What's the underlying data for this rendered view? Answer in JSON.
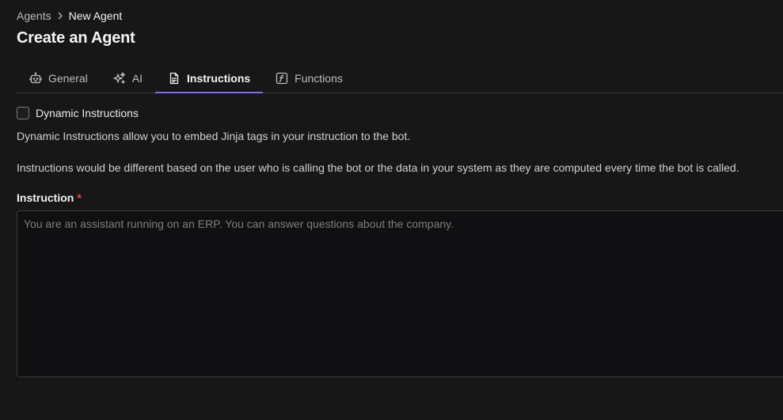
{
  "breadcrumb": {
    "parent": "Agents",
    "current": "New Agent",
    "separator_icon": "chevron-right-icon"
  },
  "page": {
    "title": "Create an Agent"
  },
  "tabs": [
    {
      "label": "General",
      "icon": "robot-icon",
      "active": false
    },
    {
      "label": "AI",
      "icon": "sparkles-icon",
      "active": false
    },
    {
      "label": "Instructions",
      "icon": "document-icon",
      "active": true
    },
    {
      "label": "Functions",
      "icon": "function-icon",
      "active": false
    }
  ],
  "dynamic_instructions": {
    "label": "Dynamic Instructions",
    "checked": false,
    "description_1": "Dynamic Instructions allow you to embed Jinja tags in your instruction to the bot.",
    "description_2": "Instructions would be different based on the user who is calling the bot or the data in your system as they are computed every time the bot is called."
  },
  "instruction_field": {
    "label": "Instruction",
    "required_marker": "*",
    "value": "",
    "placeholder": "You are an assistant running on an ERP. You can answer questions about the company."
  },
  "colors": {
    "background": "#171717",
    "accent": "#7c6cf2",
    "required": "#e5484d",
    "border": "#3a3a3a"
  }
}
